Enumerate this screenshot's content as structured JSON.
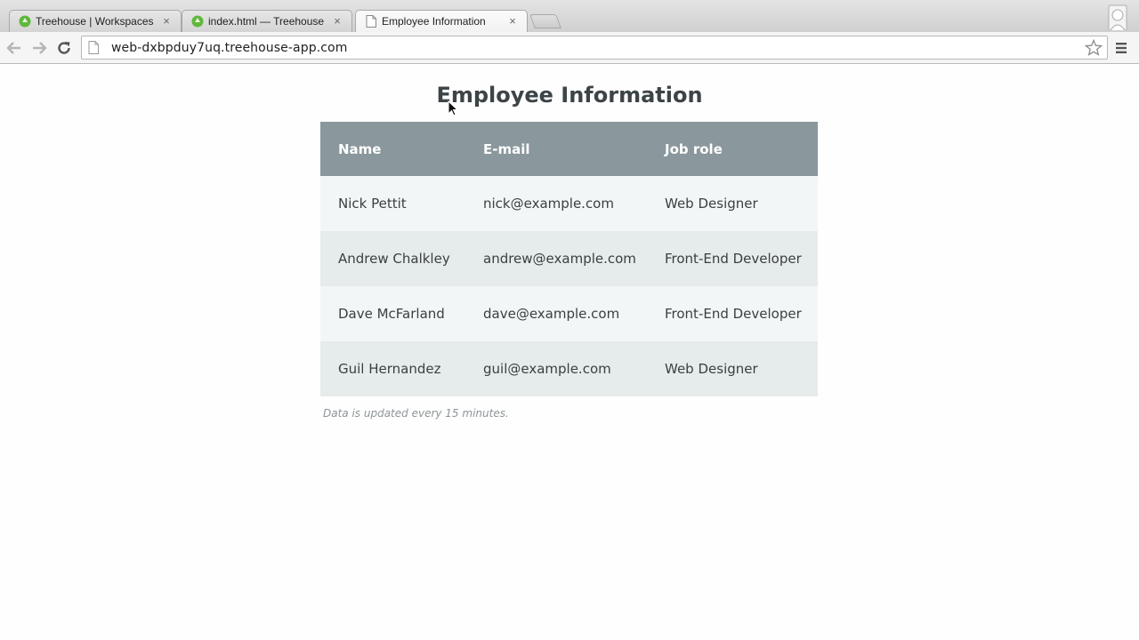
{
  "browser": {
    "tabs": [
      {
        "title": "Treehouse | Workspaces",
        "favicon": "treehouse-logo-icon",
        "active": false
      },
      {
        "title": "index.html — Treehouse Workspaces",
        "favicon": "treehouse-logo-icon",
        "active": false
      },
      {
        "title": "Employee Information",
        "favicon": "page-icon",
        "active": true
      }
    ],
    "close_glyph": "×",
    "url": "web-dxbpduy7uq.treehouse-app.com"
  },
  "page": {
    "title": "Employee Information",
    "table": {
      "headers": [
        "Name",
        "E-mail",
        "Job role"
      ],
      "rows": [
        [
          "Nick Pettit",
          "nick@example.com",
          "Web Designer"
        ],
        [
          "Andrew Chalkley",
          "andrew@example.com",
          "Front-End Developer"
        ],
        [
          "Dave McFarland",
          "dave@example.com",
          "Front-End Developer"
        ],
        [
          "Guil Hernandez",
          "guil@example.com",
          "Web Designer"
        ]
      ]
    },
    "caption": "Data is updated every 15 minutes."
  },
  "colors": {
    "header_bg": "#8a979c",
    "row_odd": "#f3f6f6",
    "row_even": "#e6ebeb",
    "favicon_green": "#5fb83b"
  }
}
